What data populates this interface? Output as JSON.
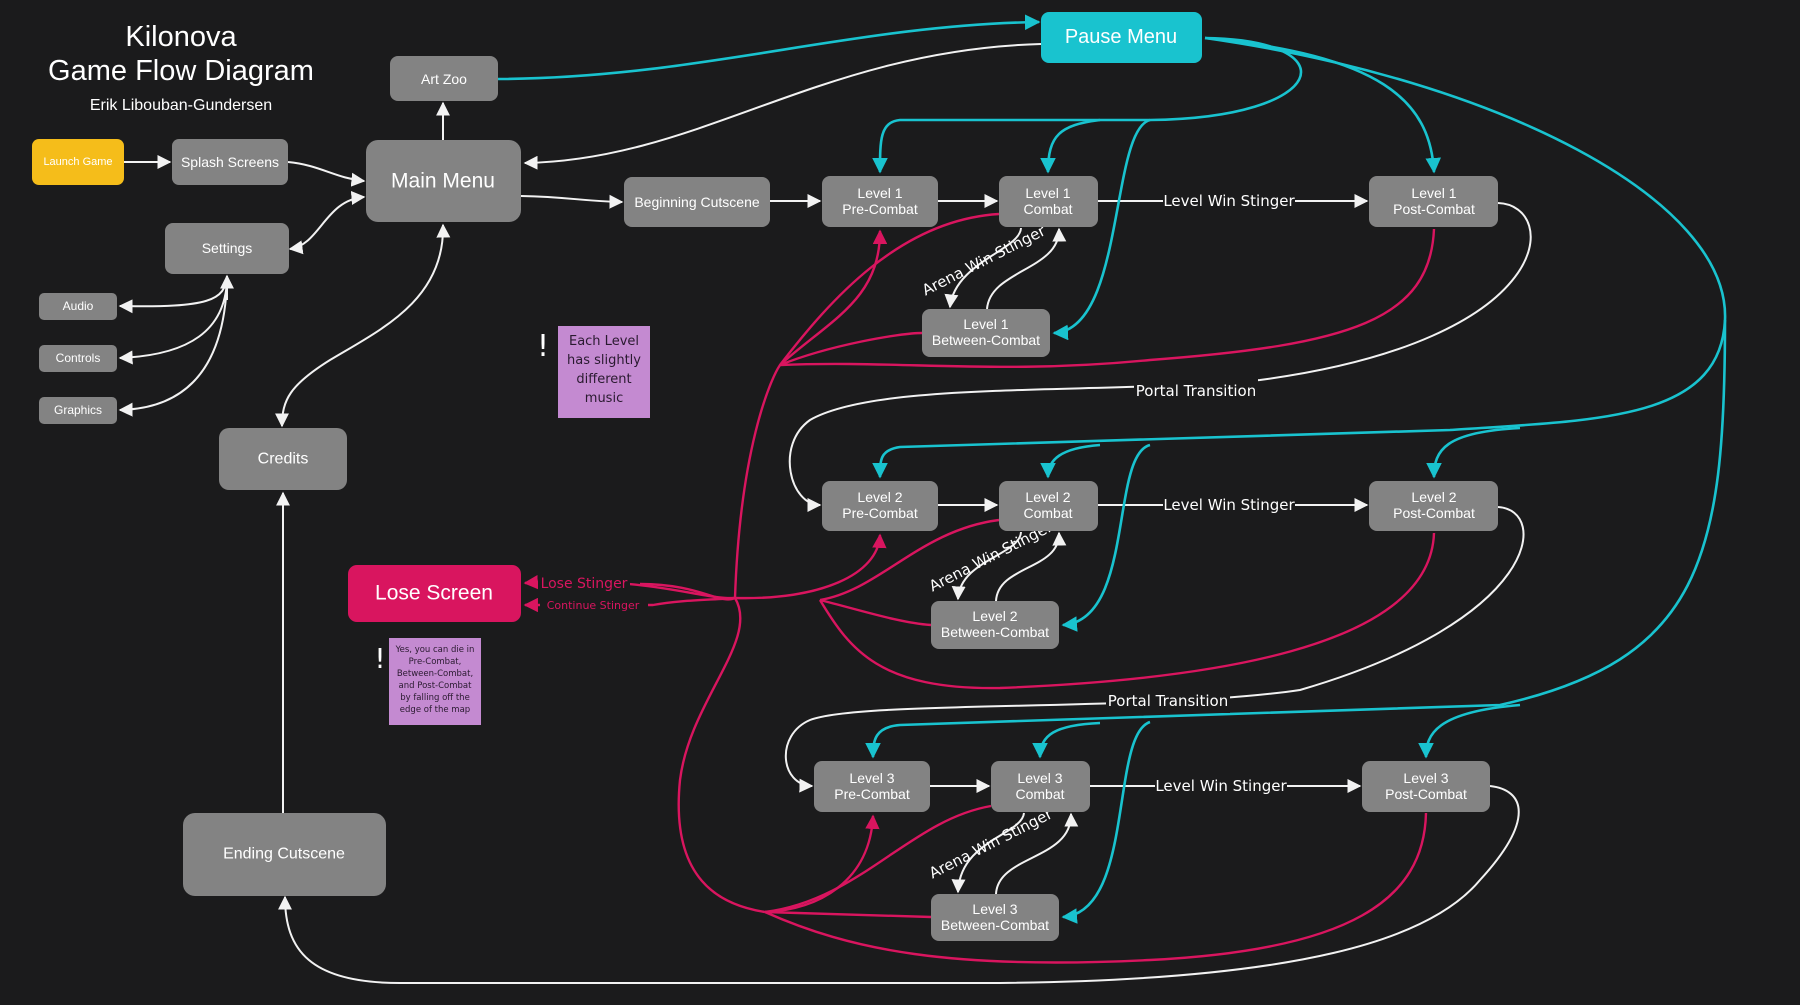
{
  "header": {
    "title_line1": "Kilonova",
    "title_line2": "Game Flow Diagram",
    "author": "Erik Libouban-Gundersen"
  },
  "colors": {
    "background": "#1b1b1c",
    "node": "#838383",
    "launch": "#f5bd1a",
    "pause": "#19c3cf",
    "lose": "#d9155f",
    "note": "#c48ad1",
    "edge_default": "#f2f2f2",
    "edge_pause": "#19c3cf",
    "edge_lose": "#d9155f"
  },
  "nodes": {
    "launch_game": "Launch Game",
    "splash_screens": "Splash Screens",
    "main_menu": "Main Menu",
    "art_zoo": "Art Zoo",
    "settings": "Settings",
    "audio": "Audio",
    "controls": "Controls",
    "graphics": "Graphics",
    "credits": "Credits",
    "ending_cutscene": "Ending Cutscene",
    "lose_screen": "Lose Screen",
    "pause_menu": "Pause Menu",
    "beginning_cutscene": "Beginning Cutscene",
    "levels": [
      {
        "pre": [
          "Level 1",
          "Pre-Combat"
        ],
        "combat": [
          "Level 1",
          "Combat"
        ],
        "post": [
          "Level 1",
          "Post-Combat"
        ],
        "between": [
          "Level 1",
          "Between-Combat"
        ]
      },
      {
        "pre": [
          "Level 2",
          "Pre-Combat"
        ],
        "combat": [
          "Level 2",
          "Combat"
        ],
        "post": [
          "Level 2",
          "Post-Combat"
        ],
        "between": [
          "Level 2",
          "Between-Combat"
        ]
      },
      {
        "pre": [
          "Level 3",
          "Pre-Combat"
        ],
        "combat": [
          "Level 3",
          "Combat"
        ],
        "post": [
          "Level 3",
          "Post-Combat"
        ],
        "between": [
          "Level 3",
          "Between-Combat"
        ]
      }
    ]
  },
  "edge_labels": {
    "level_win_stinger": "Level Win Stinger",
    "arena_win_stinger": "Arena Win Stinger",
    "portal_transition": "Portal Transition",
    "lose_stinger": "Lose Stinger",
    "continue_stinger": "Continue Stinger"
  },
  "notes": {
    "music": {
      "mark": "!",
      "lines": [
        "Each Level",
        "has slightly",
        "different",
        "music"
      ]
    },
    "death": {
      "mark": "!",
      "lines": [
        "Yes, you can die in",
        "Pre-Combat,",
        "Between-Combat,",
        "and Post-Combat",
        "by falling off the",
        "edge of the map"
      ]
    }
  }
}
